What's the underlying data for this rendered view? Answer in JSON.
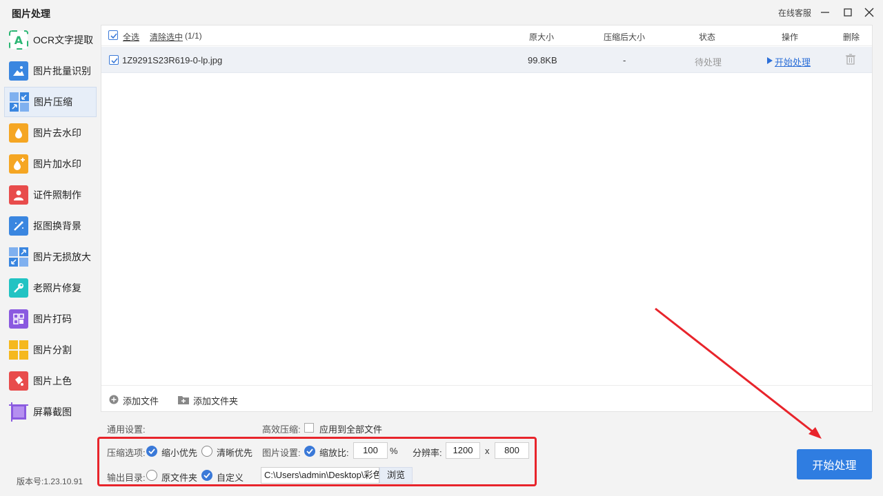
{
  "app": {
    "title": "图片处理",
    "support": "在线客服"
  },
  "sidebar": {
    "items": [
      {
        "label": "OCR文字提取",
        "icon": "ocr-icon",
        "color": "#2bb673"
      },
      {
        "label": "图片批量识别",
        "icon": "image-recognize-icon",
        "color": "#3a86e0"
      },
      {
        "label": "图片压缩",
        "icon": "compress-icon",
        "color": "#3a86e0",
        "active": true
      },
      {
        "label": "图片去水印",
        "icon": "remove-watermark-icon",
        "color": "#f5a623"
      },
      {
        "label": "图片加水印",
        "icon": "add-watermark-icon",
        "color": "#f5a623"
      },
      {
        "label": "证件照制作",
        "icon": "id-photo-icon",
        "color": "#e84c4c"
      },
      {
        "label": "抠图换背景",
        "icon": "cutout-icon",
        "color": "#3a86e0"
      },
      {
        "label": "图片无损放大",
        "icon": "enlarge-icon",
        "color": "#3a86e0"
      },
      {
        "label": "老照片修复",
        "icon": "repair-icon",
        "color": "#21c3c3"
      },
      {
        "label": "图片打码",
        "icon": "mosaic-icon",
        "color": "#8a5ae0"
      },
      {
        "label": "图片分割",
        "icon": "split-icon",
        "color": "#f5b81e"
      },
      {
        "label": "图片上色",
        "icon": "colorize-icon",
        "color": "#e84c4c"
      },
      {
        "label": "屏幕截图",
        "icon": "screenshot-icon",
        "color": "#8a5ae0"
      }
    ],
    "version": "版本号:1.23.10.91"
  },
  "list": {
    "select_all": "全选",
    "clear_selection": "清除选中",
    "count": "(1/1)",
    "columns": {
      "original_size": "原大小",
      "compressed_size": "压缩后大小",
      "status": "状态",
      "action": "操作",
      "delete": "删除"
    },
    "rows": [
      {
        "name": "1Z9291S23R619-0-lp.jpg",
        "original_size": "99.8KB",
        "compressed_size": "-",
        "status": "待处理",
        "action": "开始处理"
      }
    ],
    "add_file": "添加文件",
    "add_folder": "添加文件夹"
  },
  "settings": {
    "general_label": "通用设置:",
    "efficient_label": "高效压缩:",
    "apply_all": "应用到全部文件",
    "compress_option_label": "压缩选项:",
    "opt_small": "缩小优先",
    "opt_clear": "清晰优先",
    "image_settings_label": "图片设置:",
    "scale_label": "缩放比:",
    "scale_value": "100",
    "percent": "%",
    "resolution_label": "分辨率:",
    "res_width": "1200",
    "times": "x",
    "res_height": "800",
    "output_label": "输出目录:",
    "out_original": "原文件夹",
    "out_custom": "自定义",
    "path": "C:\\Users\\admin\\Desktop\\彩色",
    "browse": "浏览"
  },
  "start_button": "开始处理",
  "colors": {
    "accent": "#2f7de1",
    "highlight": "#e8242b"
  }
}
